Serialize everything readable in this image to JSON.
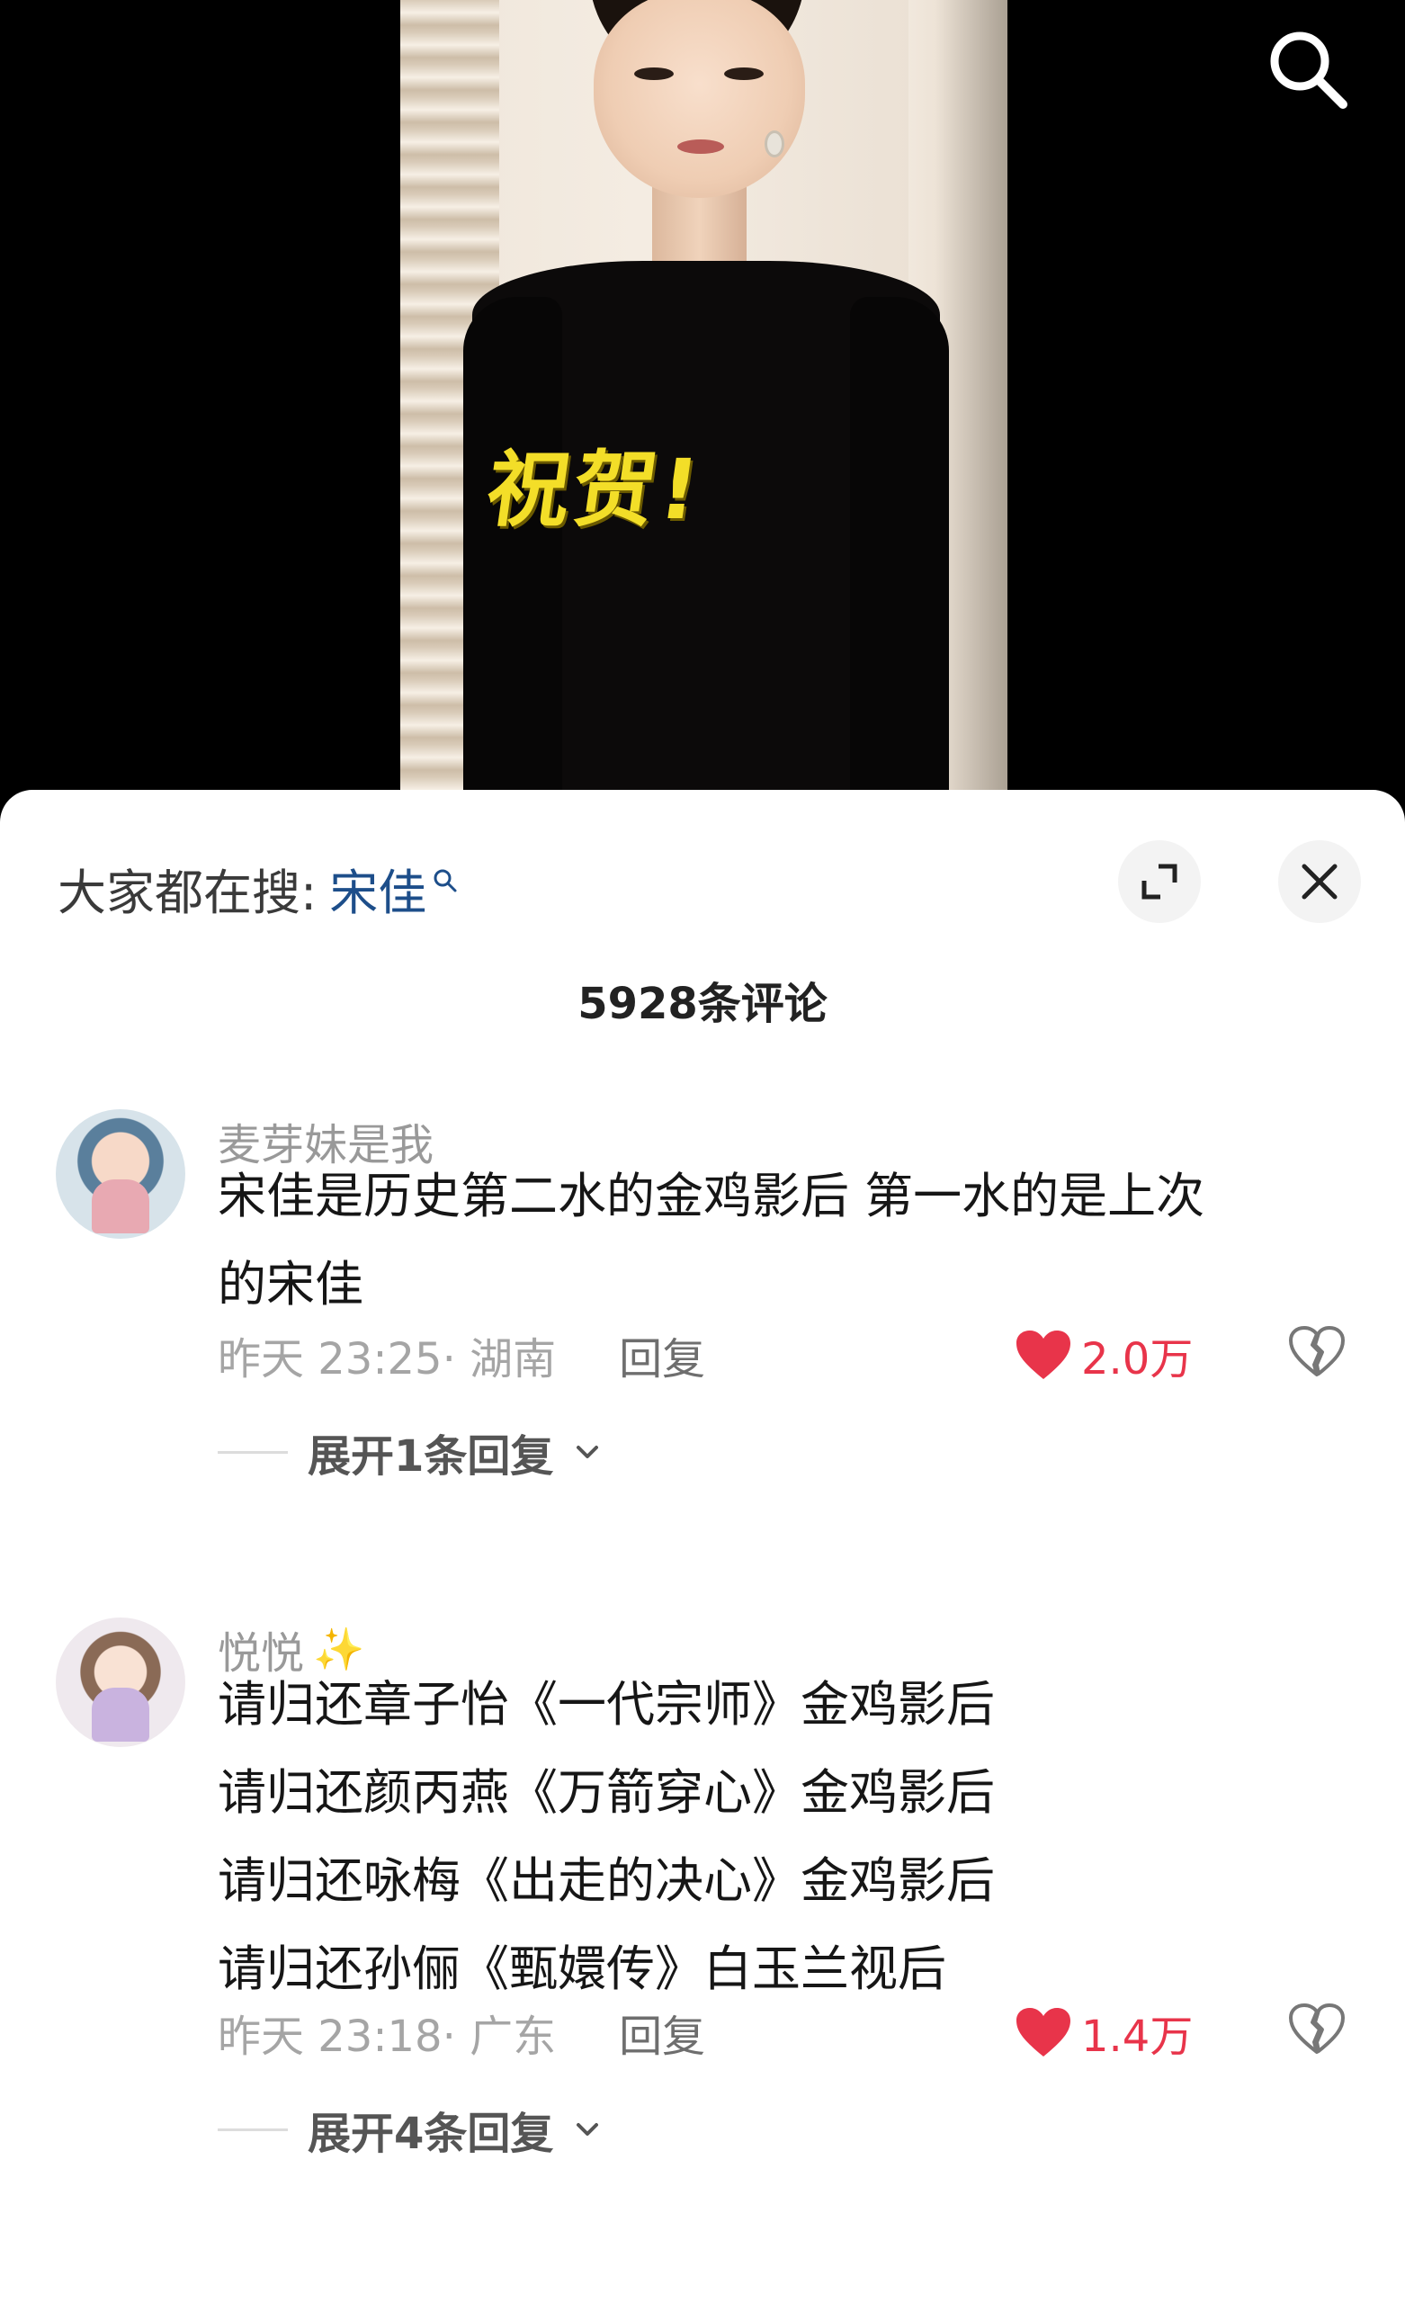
{
  "video": {
    "caption": "祝贺!"
  },
  "sheet": {
    "hot_search_prefix": "大家都在搜:",
    "hot_search_term": "宋佳",
    "comment_count": "5928条评论"
  },
  "comments": [
    {
      "username": "麦芽妹是我",
      "lines": [
        "宋佳是历史第二水的金鸡影后  第一水的是上次",
        "的宋佳"
      ],
      "time": "昨天 23:25",
      "location": "· 湖南",
      "reply_label": "回复",
      "likes": "2.0万",
      "expand_label": "展开1条回复"
    },
    {
      "username": "悦悦",
      "lines": [
        "请归还章子怡《一代宗师》金鸡影后",
        "请归还颜丙燕《万箭穿心》金鸡影后",
        "请归还咏梅《出走的决心》金鸡影后",
        "请归还孙俪《甄嬛传》白玉兰视后"
      ],
      "time": "昨天 23:18",
      "location": "· 广东",
      "reply_label": "回复",
      "likes": "1.4万",
      "expand_label": "展开4条回复"
    }
  ],
  "colors": {
    "like_red": "#e8344a",
    "search_term_blue": "#1d4e8a",
    "caption_yellow": "#f3de28"
  },
  "icons": [
    "search-icon",
    "expand-icon",
    "close-icon",
    "heart-icon",
    "broken-heart-icon",
    "chevron-down-icon",
    "sparkle-icon"
  ]
}
